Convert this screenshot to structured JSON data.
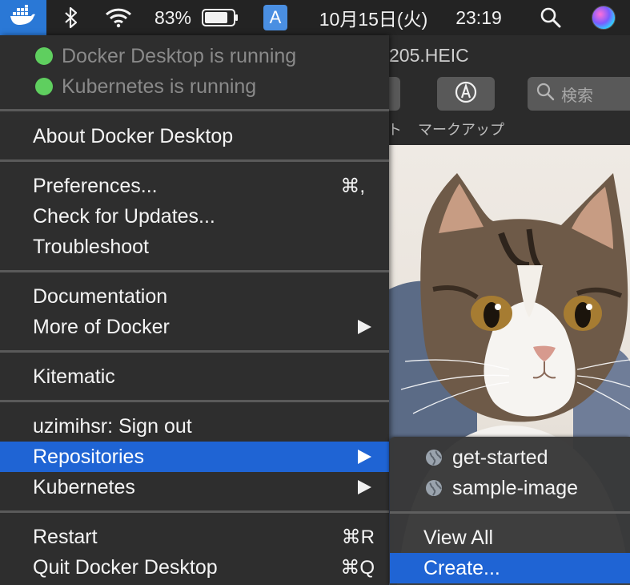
{
  "menubar": {
    "battery_percent": "83%",
    "input_source": "A",
    "date": "10月15日(火)",
    "time": "23:19"
  },
  "preview": {
    "title_fragment": "205.HEIC",
    "markup_label": "マークアップ",
    "left_label_fragment": "ト",
    "search_placeholder": "検索"
  },
  "docker_menu": {
    "status": [
      {
        "label": "Docker Desktop is running"
      },
      {
        "label": "Kubernetes is running"
      }
    ],
    "about": "About Docker Desktop",
    "preferences": "Preferences...",
    "preferences_shortcut": "⌘,",
    "check_updates": "Check for Updates...",
    "troubleshoot": "Troubleshoot",
    "documentation": "Documentation",
    "more_of_docker": "More of Docker",
    "kitematic": "Kitematic",
    "sign_out": "uzimihsr: Sign out",
    "repositories": "Repositories",
    "kubernetes": "Kubernetes",
    "restart": "Restart",
    "restart_shortcut": "⌘R",
    "quit": "Quit Docker Desktop",
    "quit_shortcut": "⌘Q"
  },
  "repositories_submenu": {
    "items": [
      {
        "label": "get-started"
      },
      {
        "label": "sample-image"
      }
    ],
    "view_all": "View All",
    "create": "Create..."
  },
  "colors": {
    "highlight": "#1f64d4",
    "status_green": "#5fcf5f",
    "docker_blue": "#2a78d6"
  }
}
